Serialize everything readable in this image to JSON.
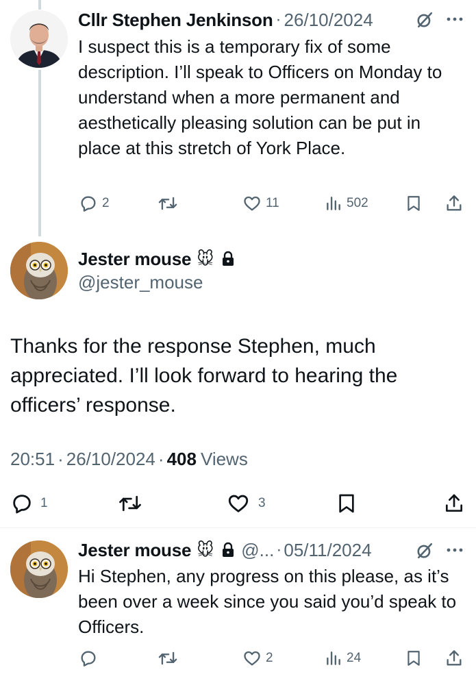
{
  "reply1": {
    "author": "Cllr Stephen Jenkinson",
    "separator": "·",
    "date": "26/10/2024",
    "text": "I suspect this is a temporary fix of some description. I’ll speak to Officers on Monday to understand when a more permanent and aesthetically pleasing solution can be put in place at this stretch of York Place.",
    "replies": "2",
    "likes": "11",
    "views": "502"
  },
  "main": {
    "author": "Jester mouse",
    "emoji": "🐭",
    "handle": "@jester_mouse",
    "text": "Thanks for the response Stephen, much appreciated. I’ll look forward to hearing the officers’ response.",
    "time": "20:51",
    "sep1": "·",
    "date": "26/10/2024",
    "sep2": "·",
    "views_count": "408",
    "views_label": "Views",
    "replies": "1",
    "likes": "3"
  },
  "reply2": {
    "author": "Jester mouse",
    "emoji": "🐭",
    "handle": "@...",
    "separator": "·",
    "date": "05/11/2024",
    "text": "Hi Stephen, any progress on this please, as it’s been over a week since you said you’d speak to Officers.",
    "likes": "2",
    "views": "24"
  },
  "colors": {
    "text": "#0f1419",
    "secondary": "#536471",
    "thread_line": "#cfd9de",
    "divider": "#eff3f4"
  },
  "icons": [
    "reply-icon",
    "retweet-icon",
    "like-icon",
    "views-icon",
    "bookmark-icon",
    "share-icon",
    "grok-icon",
    "more-icon",
    "lock-icon"
  ]
}
